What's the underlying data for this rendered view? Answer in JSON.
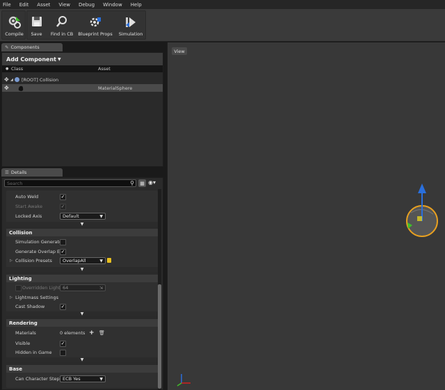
{
  "menu": [
    "File",
    "Edit",
    "Asset",
    "View",
    "Debug",
    "Window",
    "Help"
  ],
  "toolbar": {
    "compile": "Compile",
    "save": "Save",
    "find_in_cb": "Find in CB",
    "blueprint_props": "Blueprint Props",
    "simulation": "Simulation"
  },
  "components": {
    "tab": "Components",
    "add_component": "Add Component",
    "col_class": "Class",
    "col_asset": "Asset",
    "rows": [
      {
        "name": "[ROOT] Collision",
        "asset": ""
      },
      {
        "name": "",
        "asset": "MaterialSphere"
      }
    ]
  },
  "details": {
    "tab": "Details",
    "search_placeholder": "Search",
    "physics": {
      "auto_weld": "Auto Weld",
      "start_awake": "Start Awake",
      "locked_axis": "Locked Axis",
      "locked_axis_value": "Default"
    },
    "collision": {
      "title": "Collision",
      "simulation_generates": "Simulation Generate",
      "generate_overlap": "Generate Overlap Ev",
      "collision_presets": "Collision Presets",
      "collision_presets_value": "OverlapAll"
    },
    "lighting": {
      "title": "Lighting",
      "overridden_light": "Overridden Light",
      "overridden_light_value": "64",
      "lightmass_settings": "Lightmass Settings",
      "cast_shadow": "Cast Shadow"
    },
    "rendering": {
      "title": "Rendering",
      "materials": "Materials",
      "materials_value": "0 elements",
      "visible": "Visible",
      "hidden_in_game": "Hidden in Game"
    },
    "base": {
      "title": "Base",
      "can_character_step": "Can Character Step U",
      "can_character_step_value": "ECB Yes"
    }
  },
  "viewport": {
    "tab": "View"
  },
  "colors": {
    "accent": "#e8a020",
    "gizmo_up": "#2a6fdc",
    "gizmo_green": "#3fbf2a",
    "gizmo_red": "#d02020"
  }
}
